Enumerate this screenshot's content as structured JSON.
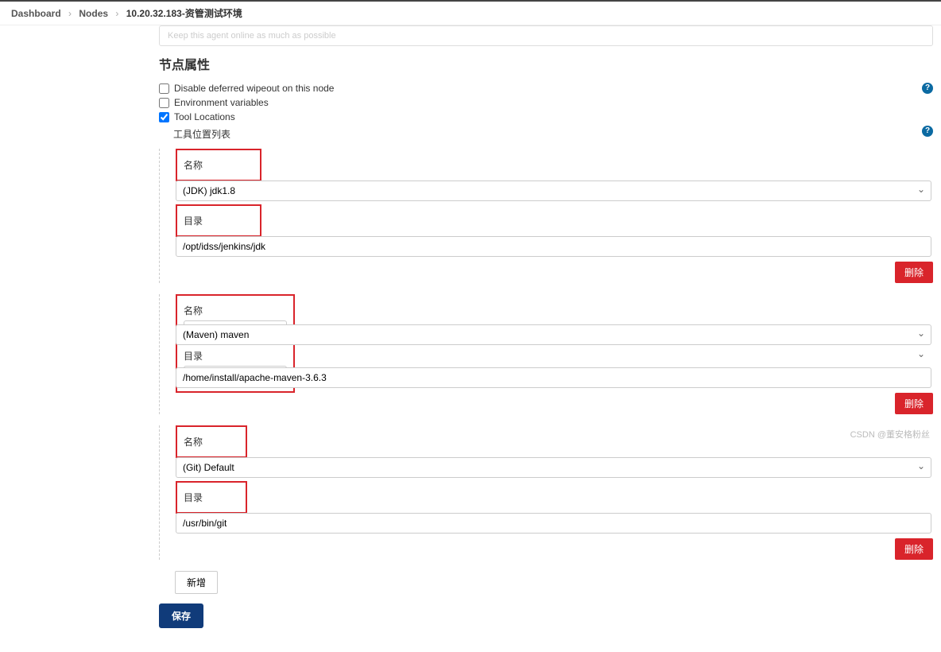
{
  "breadcrumb": {
    "dashboard": "Dashboard",
    "nodes": "Nodes",
    "current": "10.20.32.183-资管测试环境"
  },
  "faded_hint": "Keep this agent online as much as possible",
  "section_title": "节点属性",
  "checkboxes": {
    "disable_wipeout": "Disable deferred wipeout on this node",
    "env_vars": "Environment variables",
    "tool_locations": "Tool Locations"
  },
  "tool_list_header": "工具位置列表",
  "labels": {
    "name": "名称",
    "directory": "目录"
  },
  "tools": [
    {
      "name": "(JDK) jdk1.8",
      "dir": "/opt/idss/jenkins/jdk"
    },
    {
      "name": "(Maven) maven",
      "dir": "/home/install/apache-maven-3.6.3"
    },
    {
      "name": "(Git) Default",
      "dir": "/usr/bin/git"
    }
  ],
  "buttons": {
    "delete": "删除",
    "add": "新增",
    "save": "保存"
  },
  "watermark": "CSDN @董安格粉丝"
}
